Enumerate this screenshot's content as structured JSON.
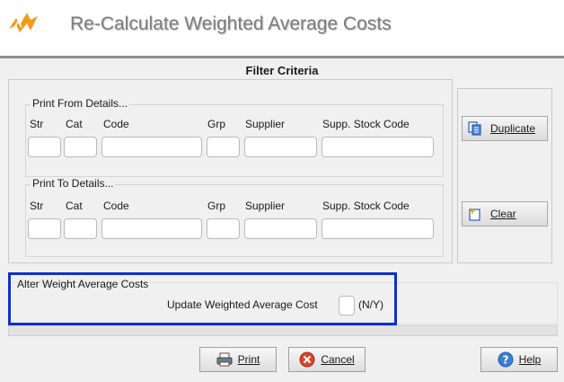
{
  "window": {
    "title": "Re-Calculate Weighted Average Costs",
    "logo": "app-logo"
  },
  "filter": {
    "section_title": "Filter Criteria",
    "from_group": {
      "legend": "Print From Details...",
      "columns": [
        "Str",
        "Cat",
        "Code",
        "Grp",
        "Supplier",
        "Supp. Stock Code"
      ],
      "values": [
        "",
        "",
        "",
        "",
        "",
        ""
      ]
    },
    "to_group": {
      "legend": "Print To Details...",
      "columns": [
        "Str",
        "Cat",
        "Code",
        "Grp",
        "Supplier",
        "Supp. Stock Code"
      ],
      "values": [
        "",
        "",
        "",
        "",
        "",
        ""
      ]
    }
  },
  "side_buttons": {
    "duplicate": {
      "label": "Duplicate",
      "icon": "duplicate-icon"
    },
    "clear": {
      "label": "Clear",
      "icon": "clear-icon"
    }
  },
  "alter": {
    "label": "Alter Weight Average Costs",
    "update_label": "Update Weighted Average Cost",
    "update_value": "",
    "hint": "(N/Y)"
  },
  "buttons": {
    "print": {
      "label": "Print",
      "icon": "printer-icon"
    },
    "cancel": {
      "label": "Cancel",
      "icon": "cancel-icon"
    },
    "help": {
      "label": "Help",
      "icon": "help-icon"
    }
  },
  "colors": {
    "highlight": "#1030c8",
    "title_text": "#7d7d7d",
    "logo_orange": "#f39a1c",
    "cancel_red": "#d9452b",
    "help_blue": "#3a7fd5"
  }
}
